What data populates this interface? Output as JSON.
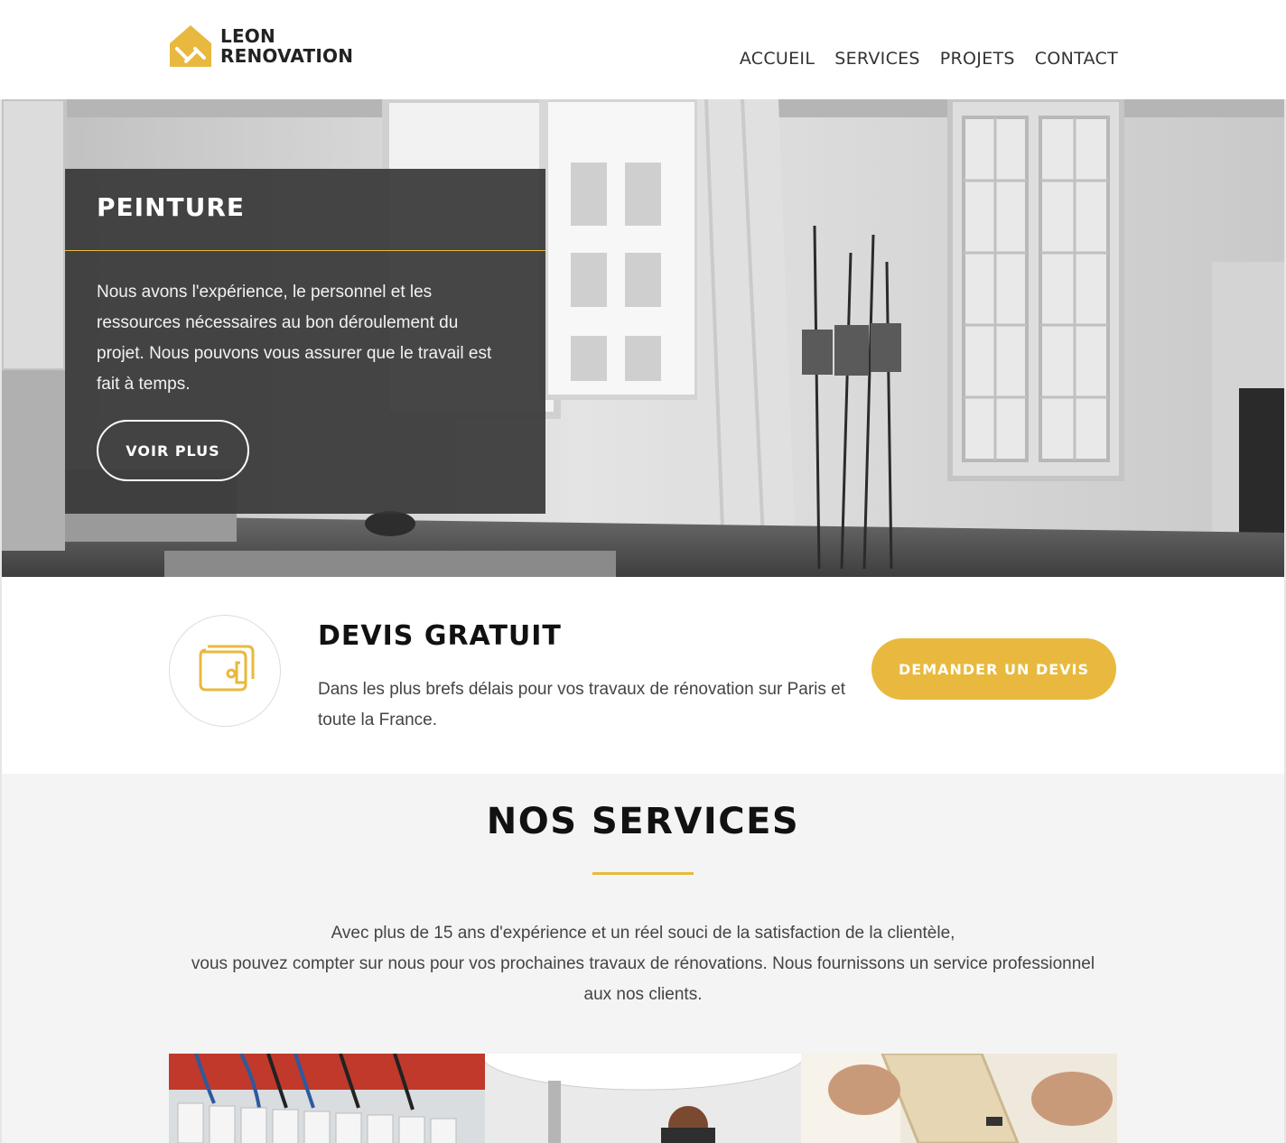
{
  "header": {
    "logo_line1": "LEON",
    "logo_line2": "RENOVATION",
    "logo_icon": "house-hammer-icon",
    "nav": [
      {
        "label": "ACCUEIL"
      },
      {
        "label": "SERVICES"
      },
      {
        "label": "PROJETS"
      },
      {
        "label": "CONTACT"
      }
    ]
  },
  "hero": {
    "title": "PEINTURE",
    "text": "Nous avons l'expérience, le personnel et les ressources nécessaires au bon déroulement du projet. Nous pouvons vous assurer que le travail est fait à temps.",
    "button_label": "VOIR PLUS"
  },
  "devis": {
    "icon": "wallet-icon",
    "title": "DEVIS GRATUIT",
    "text": "Dans les plus brefs délais pour vos travaux de rénovation sur Paris et toute la France.",
    "button_label": "DEMANDER UN DEVIS"
  },
  "services": {
    "title": "NOS SERVICES",
    "text_line1": "Avec plus de 15 ans d'expérience et un réel souci de la satisfaction de la clientèle,",
    "text_line2": "vous pouvez compter sur nous pour vos prochaines travaux de rénovations. Nous fournissons un service professionnel aux nos clients."
  },
  "colors": {
    "accent": "#e8b93e",
    "card_bg": "#373737",
    "services_bg": "#f4f4f4"
  }
}
